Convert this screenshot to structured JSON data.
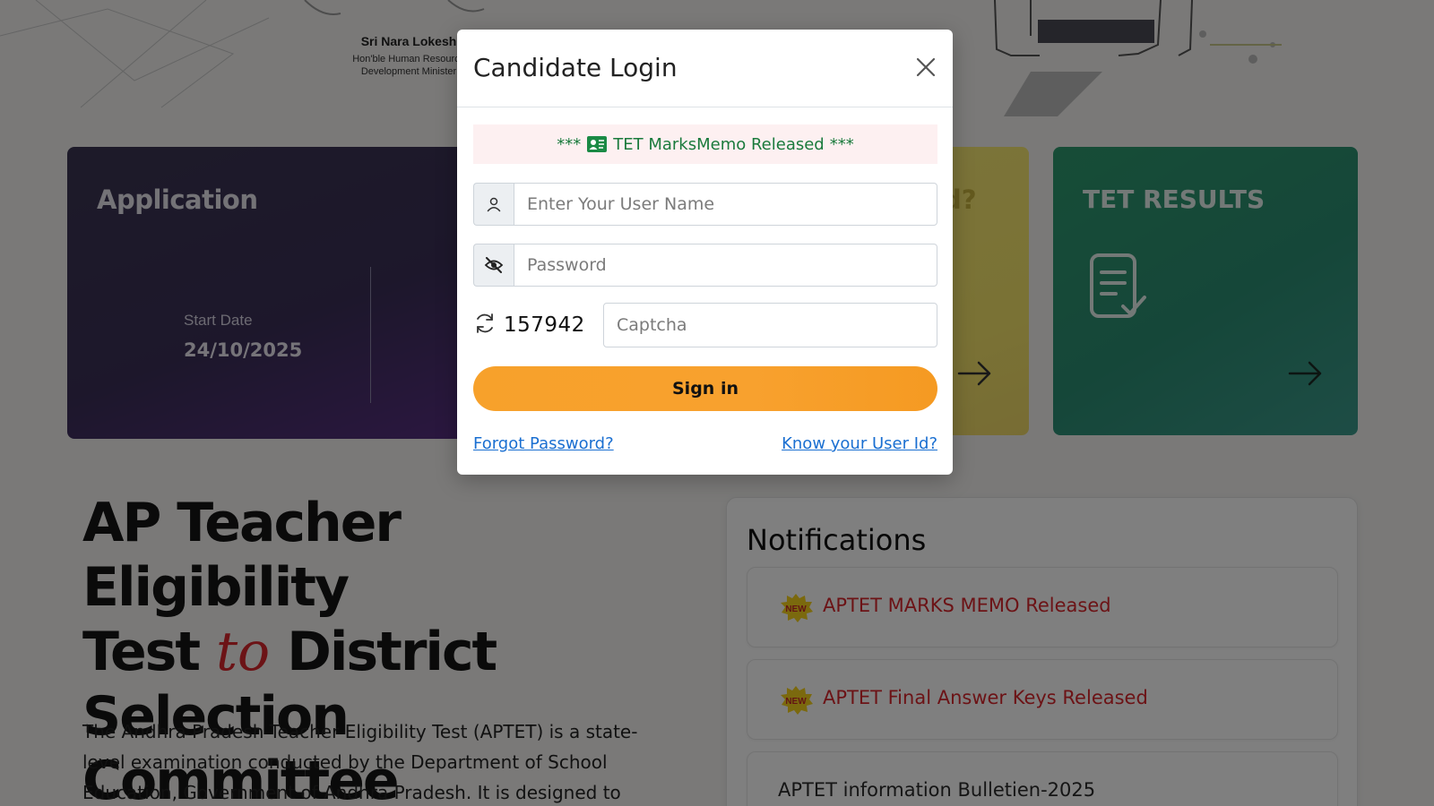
{
  "minister": {
    "name": "Sri Nara Lokesh",
    "role_line1": "Hon'ble Human Resource",
    "role_line2": "Development Minister"
  },
  "cards": {
    "application": {
      "title": "Application",
      "start_label": "Start Date",
      "start_value": "24/10/2025"
    },
    "partial_card": {
      "title_fragment": "d?"
    },
    "results": {
      "title": "TET RESULTS"
    }
  },
  "hero": {
    "line1": "AP Teacher Eligibility",
    "line2_start": "Test",
    "line2_mid": "to",
    "line2_end": "District",
    "line3": "Selection Committee",
    "intro": "The Andhra Pradesh Teacher Eligibility Test (APTET) is a state-level examination conducted by the Department of School Education, Government of Andhra Pradesh. It is designed to assess the"
  },
  "notifications": {
    "title": "Notifications",
    "items": [
      {
        "text": "APTET MARKS MEMO Released",
        "badge": "NEW"
      },
      {
        "text": "APTET Final Answer Keys Released",
        "badge": "NEW"
      },
      {
        "text": "APTET information Bulletien-2025",
        "badge": ""
      }
    ]
  },
  "modal": {
    "title": "Candidate Login",
    "alert_prefix": "***",
    "alert_text": "TET MarksMemo Released",
    "alert_suffix": "***",
    "username_placeholder": "Enter Your User Name",
    "password_placeholder": "Password",
    "captcha_code": "157942",
    "captcha_placeholder": "Captcha",
    "signin_label": "Sign in",
    "forgot_label": "Forgot Password?",
    "know_user_label": "Know your User Id?"
  },
  "colors": {
    "accent_orange": "#f7a12b",
    "link_blue": "#1a6fd1",
    "alert_green": "#1a7a3c",
    "alert_bg": "#fdf0f1",
    "notif_red": "#d8262c",
    "card_purple": "#3a2f57",
    "card_green": "#2b8e73",
    "card_yellow": "#f5e56a"
  },
  "icons": {
    "username_addon": "user-icon",
    "password_addon": "eye-slash-icon",
    "captcha_refresh": "refresh-icon",
    "close": "close-icon",
    "alert": "id-card-icon",
    "results": "document-check-icon",
    "arrows": "arrow-right-icon",
    "notif_badge": "new-badge-icon"
  }
}
